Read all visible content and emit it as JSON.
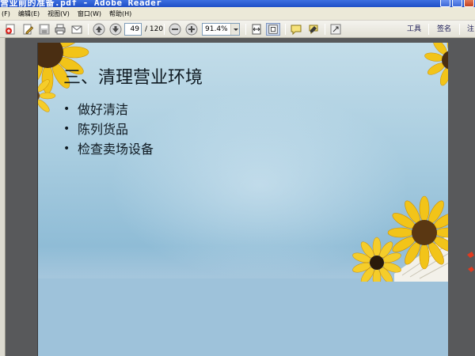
{
  "window": {
    "title": "营业前的准备.pdf - Adobe Reader"
  },
  "menubar": {
    "items": [
      "(F)",
      "编辑(E)",
      "视图(V)",
      "窗口(W)",
      "帮助(H)"
    ]
  },
  "toolbar": {
    "current_page": "49",
    "page_total": "/ 120",
    "zoom": "91.4%",
    "tools_label": "工具",
    "sign_label": "签名",
    "comment_label": "注"
  },
  "slide": {
    "title": "三、清理营业环境",
    "bullets": [
      "做好清洁",
      "陈列货品",
      "检查卖场设备"
    ]
  },
  "colors": {
    "titlebar": "#2a5bd7",
    "menubar": "#ece9d8",
    "page_sky": "#a9cde0",
    "flower_petal": "#f2c419",
    "flower_center": "#4a2e12"
  }
}
